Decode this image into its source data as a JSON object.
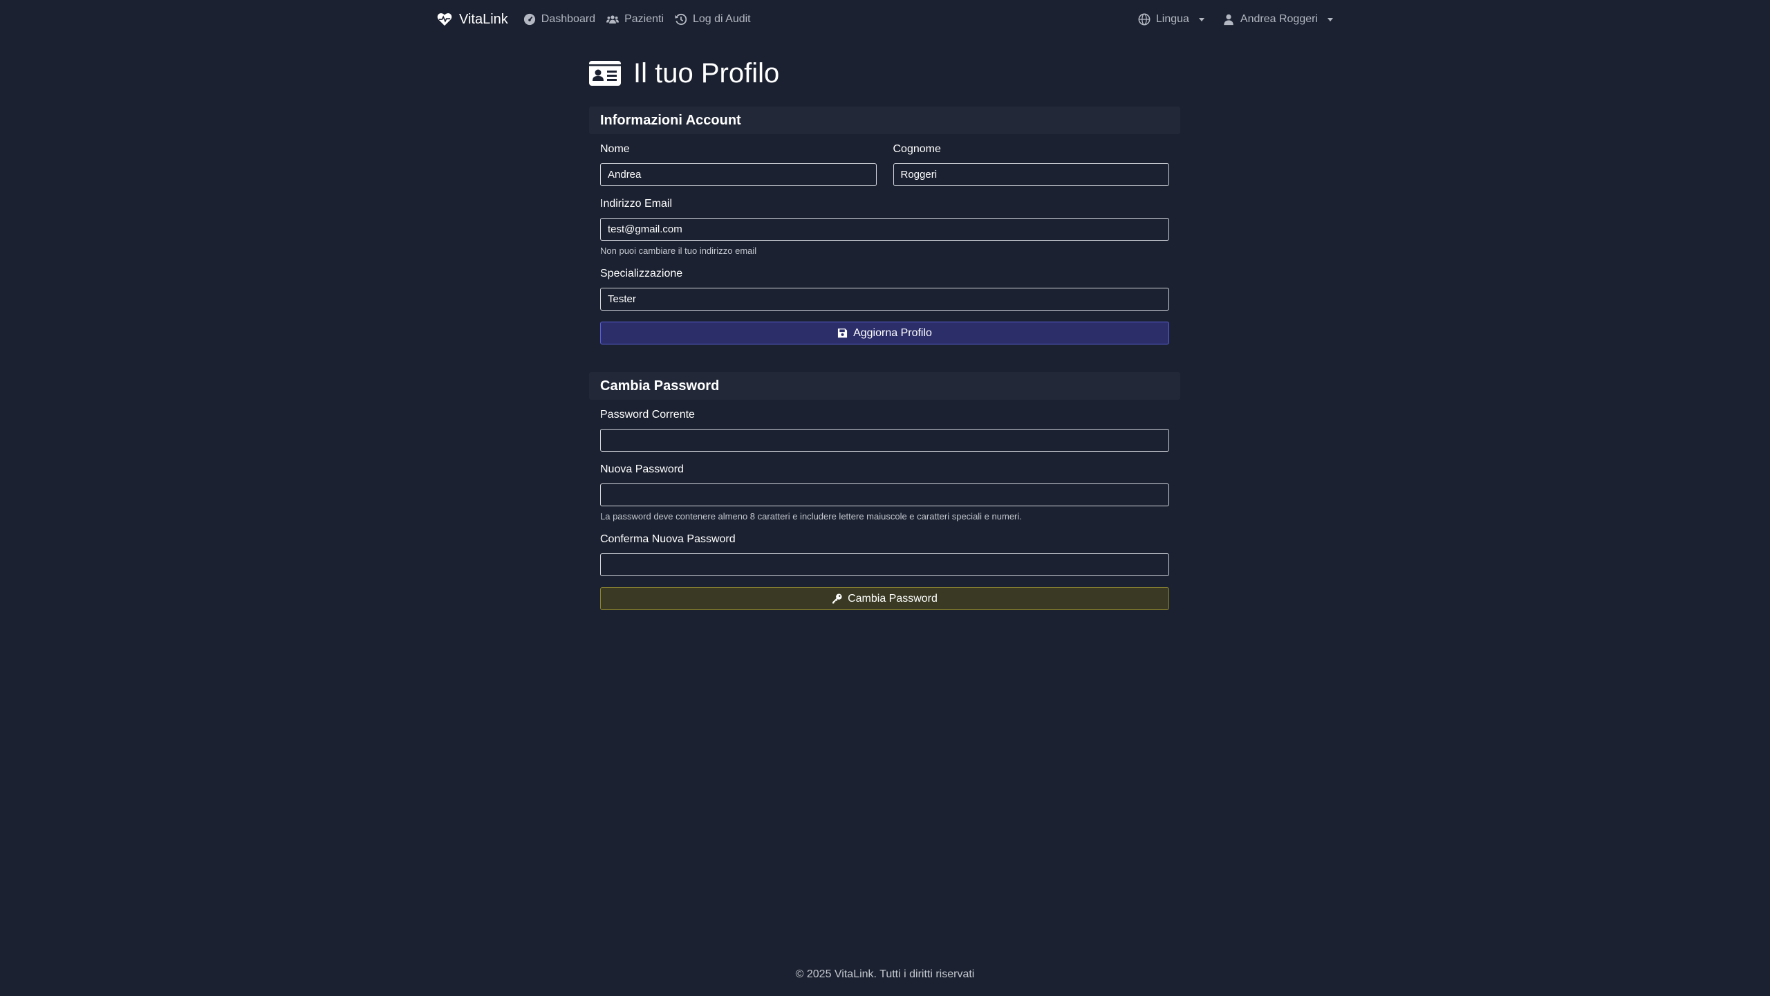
{
  "navbar": {
    "brand": "VitaLink",
    "links": {
      "dashboard": "Dashboard",
      "patients": "Pazienti",
      "audit": "Log di Audit"
    },
    "language": "Lingua",
    "user": "Andrea Roggeri"
  },
  "page": {
    "title": "Il tuo Profilo"
  },
  "account": {
    "header": "Informazioni Account",
    "first_name_label": "Nome",
    "first_name_value": "Andrea",
    "last_name_label": "Cognome",
    "last_name_value": "Roggeri",
    "email_label": "Indirizzo Email",
    "email_value": "test@gmail.com",
    "email_help": "Non puoi cambiare il tuo indirizzo email",
    "specialization_label": "Specializzazione",
    "specialization_value": "Tester",
    "submit_label": "Aggiorna Profilo"
  },
  "password": {
    "header": "Cambia Password",
    "current_label": "Password Corrente",
    "new_label": "Nuova Password",
    "new_help": "La password deve contenere almeno 8 caratteri e includere lettere maiuscole e caratteri speciali e numeri.",
    "confirm_label": "Conferma Nuova Password",
    "submit_label": "Cambia Password"
  },
  "footer": {
    "text": "© 2025 VitaLink. Tutti i diritti riservati"
  },
  "icons": {
    "brand": "heart-pulse-icon",
    "dashboard": "gauge-icon",
    "patients": "users-icon",
    "audit": "history-icon",
    "language": "globe-icon",
    "user": "user-icon",
    "profile": "id-card-icon",
    "save": "floppy-disk-icon",
    "key": "key-icon"
  },
  "colors": {
    "background": "#1b2130",
    "primary_border": "#5b5fd6",
    "warning_border": "#8c8430"
  }
}
